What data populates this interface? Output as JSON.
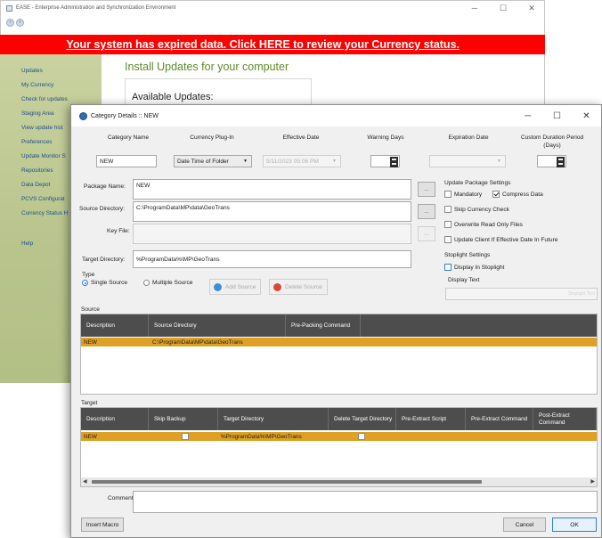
{
  "background_window": {
    "title": "EASE - Enterprise Administration and Synchronization Environment",
    "controls": [
      "─",
      "☐",
      "✕"
    ],
    "banner_text": "Your system has expired data.  Click HERE to review your Currency status.",
    "sidebar": [
      {
        "label": "Updates"
      },
      {
        "label": "My Currency"
      },
      {
        "label": "Check for updates"
      },
      {
        "label": "Staging Area"
      },
      {
        "label": "View update hist"
      },
      {
        "label": "Preferences"
      },
      {
        "label": "Update Monitor S"
      },
      {
        "label": "Repositories"
      },
      {
        "label": "Data Depot"
      },
      {
        "label": "PCVS Configurat"
      },
      {
        "label": "Currency Status H"
      },
      {
        "label": "Help"
      }
    ],
    "main_heading": "Install Updates for your computer",
    "available_updates": "Available Updates:"
  },
  "dialog": {
    "title": "Category Details :: NEW",
    "controls": [
      "─",
      "☐",
      "✕"
    ],
    "columns": {
      "category_name": "Category Name",
      "currency_plugin": "Currency Plug-In",
      "effective_date": "Effective Date",
      "warning_days": "Warning Days",
      "expiration_date": "Expiration Date",
      "custom_duration": "Custom Duration Period (Days)"
    },
    "values": {
      "category_name": "NEW",
      "currency_plugin": "Date Time of Folder",
      "effective_date": "5/11/2023 05:06 PM"
    },
    "package_name_label": "Package Name:",
    "package_name_value": "NEW",
    "source_dir_label": "Source Directory:",
    "source_dir_value": "C:\\ProgramData\\MP\\data\\GeoTrans",
    "key_file_label": "Key File:",
    "key_file_value": "",
    "target_dir_label": "Target Directory:",
    "target_dir_value": "%ProgramData%\\MP\\GeoTrans",
    "browse_label": "...",
    "type_label": "Type",
    "single_source": "Single Source",
    "multiple_source": "Multiple Source",
    "add_source": "Add Source",
    "delete_source": "Delete Source",
    "settings_title": "Update Package Settings",
    "mandatory": "Mandatory",
    "compress_data": "Compress Data",
    "skip_currency": "Skip Currency Check",
    "overwrite_readonly": "Overwrite Read Only Files",
    "update_client": "Update Client If Effective Date In Future",
    "stoplight_title": "Stoplight Settings",
    "display_in_stoplight": "Display In Stoplight",
    "display_text": "Display Text",
    "display_text_value": "Stoplight Text",
    "source_section": "Source",
    "source_headers": [
      "Description",
      "Source Directory",
      "Pre-Packing Command"
    ],
    "source_rows": [
      {
        "description": "NEW",
        "source_directory": "C:\\ProgramData\\MP\\data\\GeoTrans",
        "pre_packing": ""
      }
    ],
    "target_section": "Target",
    "target_headers": [
      "Description",
      "Skip Backup",
      "Target Directory",
      "Delete Target Directory",
      "Pre-Extract Script",
      "Pre-Extract Command",
      "Post-Extract Command"
    ],
    "target_rows": [
      {
        "description": "NEW",
        "target_directory": "%ProgramData%\\MP\\GeoTrans"
      }
    ],
    "comments_label": "Comments",
    "comments_value": "",
    "insert_macro": "Insert Macro",
    "cancel": "Cancel",
    "ok": "OK"
  },
  "colors": {
    "banner": "#ff0000",
    "selected_row": "#dea125",
    "grid_header": "#4d4d4d",
    "sidebar": "#c0ca94",
    "accent_blue": "#2e7fd8"
  },
  "icons": {
    "add_source": "plus-circle-icon",
    "delete_source": "minus-circle-icon",
    "dialog": "app-icon"
  }
}
